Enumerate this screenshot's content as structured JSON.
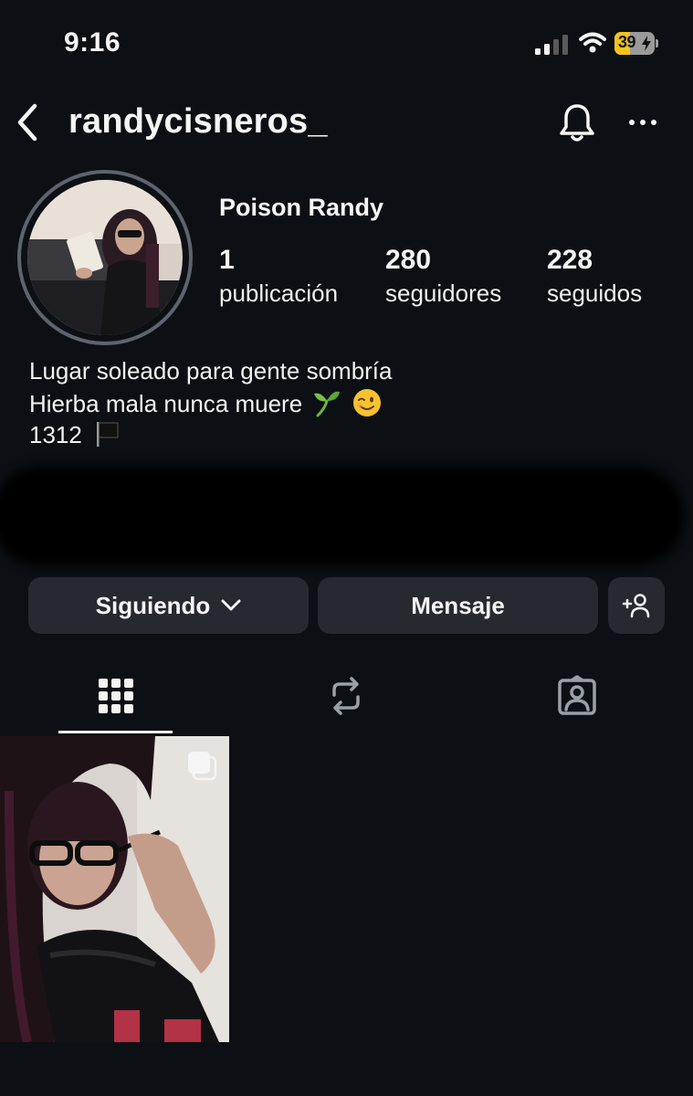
{
  "status_bar": {
    "time": "9:16",
    "battery_percent": "39",
    "battery_level": 0.39,
    "signal_icon": "cellular-signal-icon",
    "wifi_icon": "wifi-icon"
  },
  "header": {
    "username": "randycisneros_",
    "back_icon": "chevron-left-icon",
    "bell_icon": "bell-icon",
    "more_icon": "ellipsis-icon"
  },
  "profile": {
    "display_name": "Poison Randy",
    "stats": [
      {
        "value": "1",
        "label": "publicación"
      },
      {
        "value": "280",
        "label": "seguidores"
      },
      {
        "value": "228",
        "label": "seguidos"
      }
    ],
    "bio_lines": [
      "Lugar soleado para gente sombría",
      "Hierba mala nunca muere",
      "1312"
    ],
    "bio_emojis": [
      "seedling-emoji",
      "winking-face-emoji",
      "black-flag-emoji"
    ]
  },
  "actions": {
    "following_label": "Siguiendo",
    "message_label": "Mensaje",
    "suggest_icon": "add-person-icon"
  },
  "tabs": {
    "items": [
      "grid-icon",
      "reels-repost-icon",
      "tagged-icon"
    ],
    "active": "grid-icon"
  },
  "posts": [
    {
      "type": "carousel",
      "icon": "multiple-photos-icon"
    }
  ],
  "colors": {
    "background": "#0c1014",
    "button": "#262a30",
    "ring": "#5d6470",
    "battery": "#f3c41b"
  }
}
